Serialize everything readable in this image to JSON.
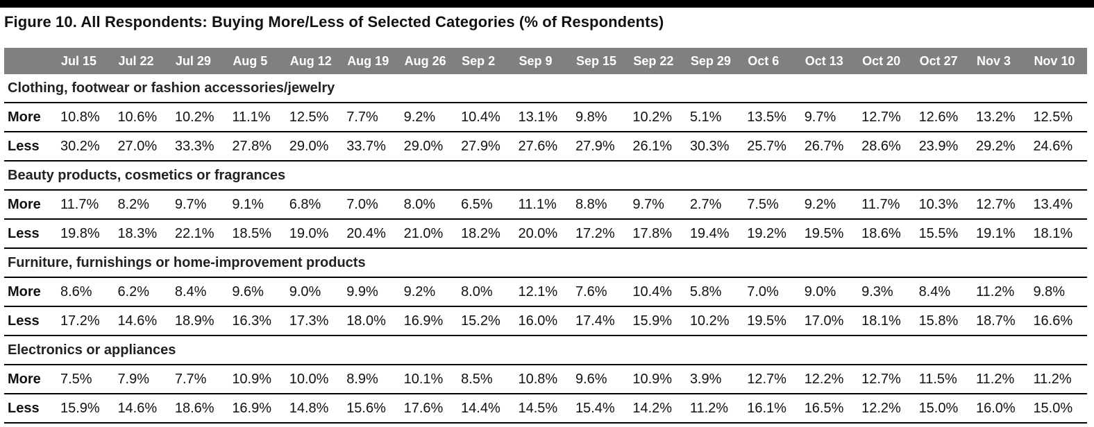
{
  "title": "Figure 10. All Respondents: Buying More/Less of Selected Categories (% of Respondents)",
  "chart_data": {
    "type": "table",
    "title": "Figure 10. All Respondents: Buying More/Less of Selected Categories (% of Respondents)",
    "columns": [
      "Jul 15",
      "Jul 22",
      "Jul 29",
      "Aug 5",
      "Aug 12",
      "Aug 19",
      "Aug 26",
      "Sep 2",
      "Sep 9",
      "Sep 15",
      "Sep 22",
      "Sep 29",
      "Oct 6",
      "Oct 13",
      "Oct 20",
      "Oct 27",
      "Nov 3",
      "Nov 10"
    ],
    "categories": [
      {
        "name": "Clothing, footwear or fashion accessories/jewelry",
        "rows": [
          {
            "label": "More",
            "values": [
              "10.8%",
              "10.6%",
              "10.2%",
              "11.1%",
              "12.5%",
              "7.7%",
              "9.2%",
              "10.4%",
              "13.1%",
              "9.8%",
              "10.2%",
              "5.1%",
              "13.5%",
              "9.7%",
              "12.7%",
              "12.6%",
              "13.2%",
              "12.5%"
            ]
          },
          {
            "label": "Less",
            "values": [
              "30.2%",
              "27.0%",
              "33.3%",
              "27.8%",
              "29.0%",
              "33.7%",
              "29.0%",
              "27.9%",
              "27.6%",
              "27.9%",
              "26.1%",
              "30.3%",
              "25.7%",
              "26.7%",
              "28.6%",
              "23.9%",
              "29.2%",
              "24.6%"
            ]
          }
        ]
      },
      {
        "name": "Beauty products, cosmetics or fragrances",
        "rows": [
          {
            "label": "More",
            "values": [
              "11.7%",
              "8.2%",
              "9.7%",
              "9.1%",
              "6.8%",
              "7.0%",
              "8.0%",
              "6.5%",
              "11.1%",
              "8.8%",
              "9.7%",
              "2.7%",
              "7.5%",
              "9.2%",
              "11.7%",
              "10.3%",
              "12.7%",
              "13.4%"
            ]
          },
          {
            "label": "Less",
            "values": [
              "19.8%",
              "18.3%",
              "22.1%",
              "18.5%",
              "19.0%",
              "20.4%",
              "21.0%",
              "18.2%",
              "20.0%",
              "17.2%",
              "17.8%",
              "19.4%",
              "19.2%",
              "19.5%",
              "18.6%",
              "15.5%",
              "19.1%",
              "18.1%"
            ]
          }
        ]
      },
      {
        "name": "Furniture, furnishings or home-improvement products",
        "rows": [
          {
            "label": "More",
            "values": [
              "8.6%",
              "6.2%",
              "8.4%",
              "9.6%",
              "9.0%",
              "9.9%",
              "9.2%",
              "8.0%",
              "12.1%",
              "7.6%",
              "10.4%",
              "5.8%",
              "7.0%",
              "9.0%",
              "9.3%",
              "8.4%",
              "11.2%",
              "9.8%"
            ]
          },
          {
            "label": "Less",
            "values": [
              "17.2%",
              "14.6%",
              "18.9%",
              "16.3%",
              "17.3%",
              "18.0%",
              "16.9%",
              "15.2%",
              "16.0%",
              "17.4%",
              "15.9%",
              "10.2%",
              "19.5%",
              "17.0%",
              "18.1%",
              "15.8%",
              "18.7%",
              "16.6%"
            ]
          }
        ]
      },
      {
        "name": "Electronics or appliances",
        "rows": [
          {
            "label": "More",
            "values": [
              "7.5%",
              "7.9%",
              "7.7%",
              "10.9%",
              "10.0%",
              "8.9%",
              "10.1%",
              "8.5%",
              "10.8%",
              "9.6%",
              "10.9%",
              "3.9%",
              "12.7%",
              "12.2%",
              "12.7%",
              "11.5%",
              "11.2%",
              "11.2%"
            ]
          },
          {
            "label": "Less",
            "values": [
              "15.9%",
              "14.6%",
              "18.6%",
              "16.9%",
              "14.8%",
              "15.6%",
              "17.6%",
              "14.4%",
              "14.5%",
              "15.4%",
              "14.2%",
              "11.2%",
              "16.1%",
              "16.5%",
              "12.2%",
              "15.0%",
              "16.0%",
              "15.0%"
            ]
          }
        ]
      }
    ]
  },
  "colors": {
    "header_bg": "#808080",
    "header_text": "#ffffff",
    "top_bar": "#000000",
    "rule": "#000000"
  }
}
